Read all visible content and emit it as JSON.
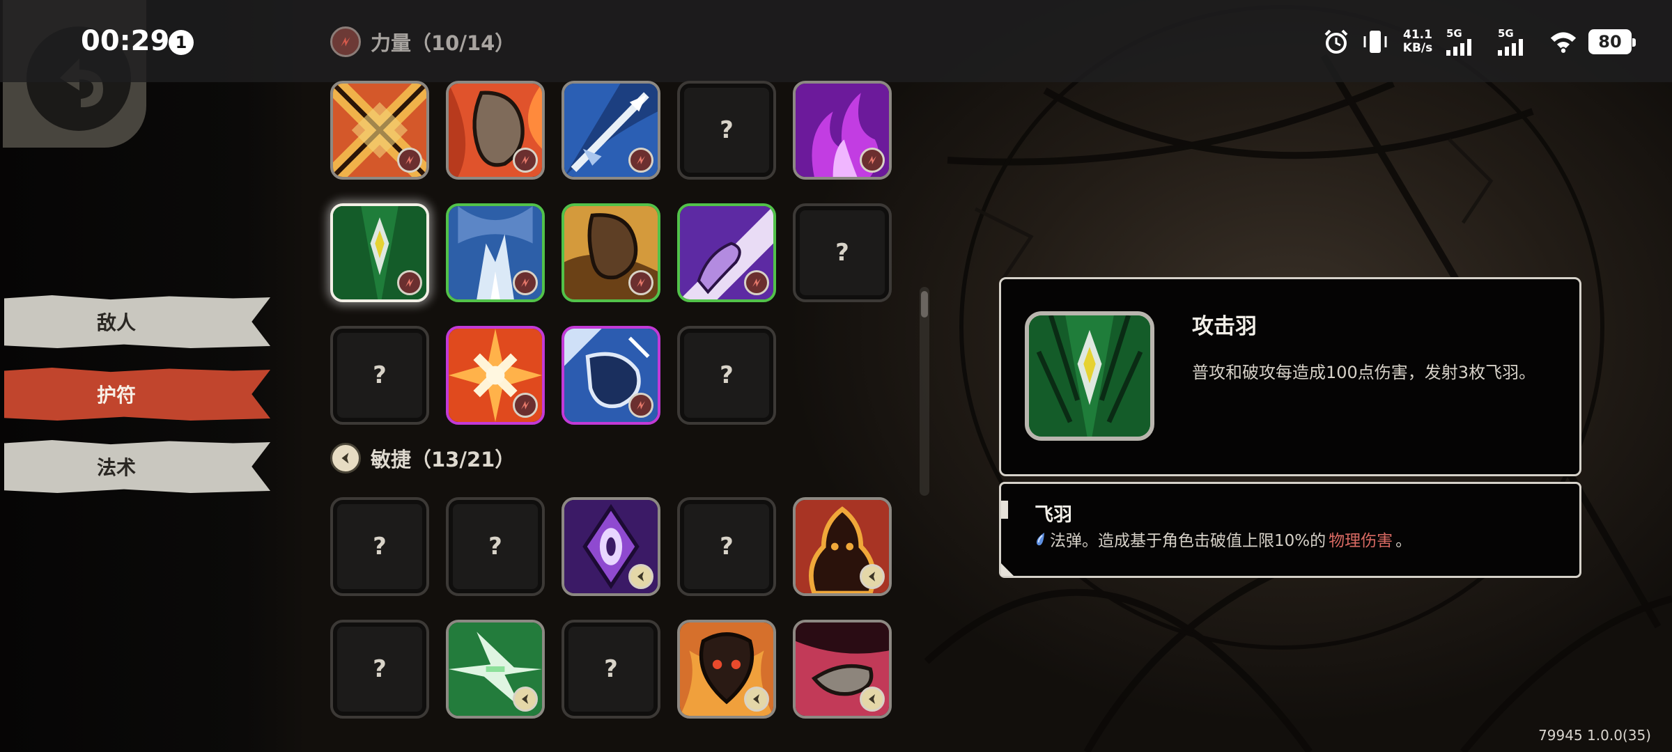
{
  "status_bar": {
    "time": "00:29",
    "notification_count": "1",
    "net_speed_value": "41.1",
    "net_speed_unit": "KB/s",
    "signal_1_label": "5G",
    "signal_2_label": "5G",
    "battery": "80"
  },
  "side_tabs": {
    "enemy": "敌人",
    "charm": "护符",
    "spell": "法术",
    "active": "charm"
  },
  "sections": {
    "strength": {
      "label": "力量（10/14）",
      "cards": [
        {
          "state": "owned",
          "rarity": "common",
          "icon": "cross-slash-art",
          "attr": "strength"
        },
        {
          "state": "owned",
          "rarity": "common",
          "icon": "fist-flame-art",
          "attr": "strength"
        },
        {
          "state": "owned",
          "rarity": "common",
          "icon": "spear-ice-art",
          "attr": "strength"
        },
        {
          "state": "locked",
          "label": "?"
        },
        {
          "state": "owned",
          "rarity": "common",
          "icon": "purple-flame-art",
          "attr": "strength"
        },
        {
          "state": "owned",
          "rarity": "selected",
          "icon": "attack-feather-art",
          "attr": "strength"
        },
        {
          "state": "owned",
          "rarity": "uncommon",
          "icon": "ice-burst-art",
          "attr": "strength"
        },
        {
          "state": "owned",
          "rarity": "uncommon",
          "icon": "golden-fist-art",
          "attr": "strength"
        },
        {
          "state": "owned",
          "rarity": "uncommon",
          "icon": "violet-hand-art",
          "attr": "strength"
        },
        {
          "state": "locked",
          "label": "?"
        },
        {
          "state": "locked",
          "label": "?"
        },
        {
          "state": "owned",
          "rarity": "epic",
          "icon": "flame-burst-art",
          "attr": "strength"
        },
        {
          "state": "owned",
          "rarity": "epic",
          "icon": "blue-gauntlet-art",
          "attr": "strength"
        },
        {
          "state": "locked",
          "label": "?"
        }
      ]
    },
    "agility": {
      "label": "敏捷（13/21）",
      "cards": [
        {
          "state": "locked",
          "label": "?"
        },
        {
          "state": "locked",
          "label": "?"
        },
        {
          "state": "owned",
          "rarity": "common",
          "icon": "purple-eye-art",
          "attr": "agility"
        },
        {
          "state": "locked",
          "label": "?"
        },
        {
          "state": "owned",
          "rarity": "common",
          "icon": "flame-spirit-art",
          "attr": "agility"
        },
        {
          "state": "locked",
          "label": "?"
        },
        {
          "state": "owned",
          "rarity": "common",
          "icon": "green-lightning-art",
          "attr": "agility"
        },
        {
          "state": "locked",
          "label": "?"
        },
        {
          "state": "owned",
          "rarity": "common",
          "icon": "demon-mask-art",
          "attr": "agility"
        },
        {
          "state": "owned",
          "rarity": "common",
          "icon": "crimson-hand-art",
          "attr": "agility"
        }
      ]
    }
  },
  "detail": {
    "title": "攻击羽",
    "description": "普攻和破攻每造成100点伤害，发射3枚飞羽。",
    "effect_name": "飞羽",
    "effect_text_before": "法弹。造成基于角色击破值上限10%的",
    "effect_highlight": "物理伤害",
    "effect_text_after": "。"
  },
  "version": "79945 1.0.0(35)",
  "colors": {
    "charm_tab": "#c1452d",
    "uncommon_border": "#52c24a",
    "epic_border": "#c23ad6",
    "highlight_text": "#d96a63"
  }
}
